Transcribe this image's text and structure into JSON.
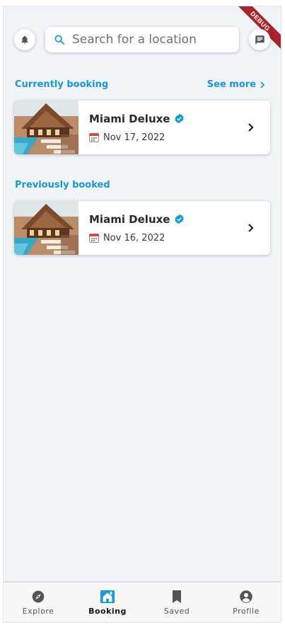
{
  "debug_banner": "DEBUG",
  "search": {
    "placeholder": "Search for a location"
  },
  "current": {
    "title": "Currently booking",
    "see_more": "See more",
    "items": [
      {
        "name": "Miami Deluxe",
        "date": "Nov 17, 2022"
      }
    ]
  },
  "previous": {
    "title": "Previously booked",
    "items": [
      {
        "name": "Miami Deluxe",
        "date": "Nov 16, 2022"
      }
    ]
  },
  "nav": {
    "items": [
      {
        "label": "Explore",
        "icon": "compass-icon"
      },
      {
        "label": "Booking",
        "icon": "home-icon"
      },
      {
        "label": "Saved",
        "icon": "bookmark-icon"
      },
      {
        "label": "Profile",
        "icon": "account-circle-icon"
      }
    ],
    "active": "Booking"
  },
  "colors": {
    "accent": "#1a97d4",
    "background": "#f0f3f8",
    "banner": "#a8232a"
  }
}
